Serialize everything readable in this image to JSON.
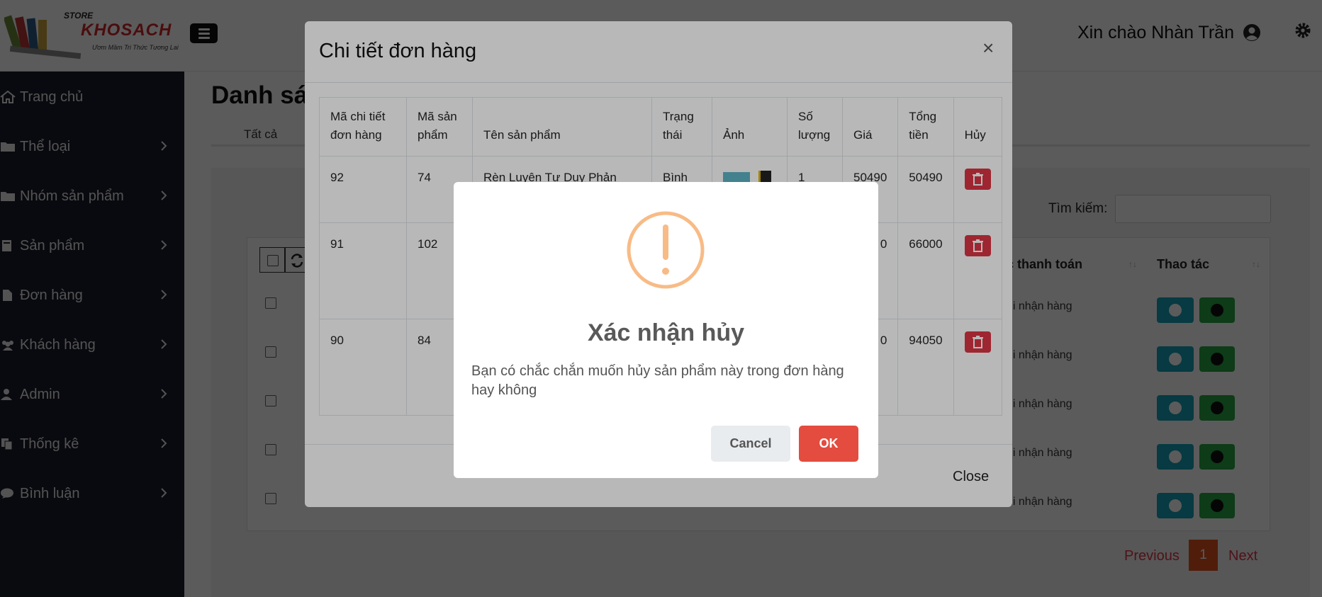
{
  "header": {
    "logo_store": "STORE",
    "logo_name": "KHOSACH",
    "logo_slogan": "Ươm Mầm Tri Thức Tương Lai",
    "greeting": "Xin chào Nhàn Trần"
  },
  "sidebar": {
    "items": [
      {
        "label": "Trang chủ",
        "icon": "home-icon"
      },
      {
        "label": "Thể loại",
        "icon": "folder-icon"
      },
      {
        "label": "Nhóm sản phẩm",
        "icon": "folder-icon"
      },
      {
        "label": "Sản phẩm",
        "icon": "book-icon"
      },
      {
        "label": "Đơn hàng",
        "icon": "file-icon"
      },
      {
        "label": "Khách hàng",
        "icon": "users-icon"
      },
      {
        "label": "Admin",
        "icon": "user-icon"
      },
      {
        "label": "Thống kê",
        "icon": "copy-icon"
      },
      {
        "label": "Bình luận",
        "icon": "comment-icon"
      }
    ]
  },
  "main": {
    "title": "Danh sác",
    "tab_all": "Tất cả",
    "search_label": "Tìm kiếm:",
    "col_payment": "c thanh toán",
    "col_actions": "Thao tác",
    "row_payment": "hi nhận hàng",
    "pager": {
      "previous": "Previous",
      "page": "1",
      "next": "Next"
    }
  },
  "modal": {
    "title": "Chi tiết đơn hàng",
    "close_x": "×",
    "headers": [
      "Mã chi tiết đơn hàng",
      "Mã sản phẩm",
      "Tên sản phẩm",
      "Trạng thái",
      "Ảnh",
      "Số lượng",
      "Giá",
      "Tổng tiền",
      "Hủy"
    ],
    "rows": [
      {
        "detail_id": "92",
        "product_id": "74",
        "name": "Rèn Luyện Tư Duy Phản Biện",
        "status": "Bình",
        "qty": "1",
        "price": "50490",
        "total": "50490"
      },
      {
        "detail_id": "91",
        "product_id": "102",
        "name": "",
        "status": "",
        "qty": "",
        "price": "0",
        "total": "66000"
      },
      {
        "detail_id": "90",
        "product_id": "84",
        "name": "",
        "status": "",
        "qty": "",
        "price": "0",
        "total": "94050"
      }
    ],
    "close_button": "Close"
  },
  "alert": {
    "title": "Xác nhận hủy",
    "text": "Bạn có chắc chắn muốn hủy sản phẩm này trong đơn hàng hay không",
    "cancel": "Cancel",
    "ok": "OK"
  },
  "colors": {
    "sidebar_bg": "#1a1f2b",
    "danger": "#dc3545",
    "warning_icon": "#f8bb86",
    "ok_button": "#e34c3e"
  }
}
